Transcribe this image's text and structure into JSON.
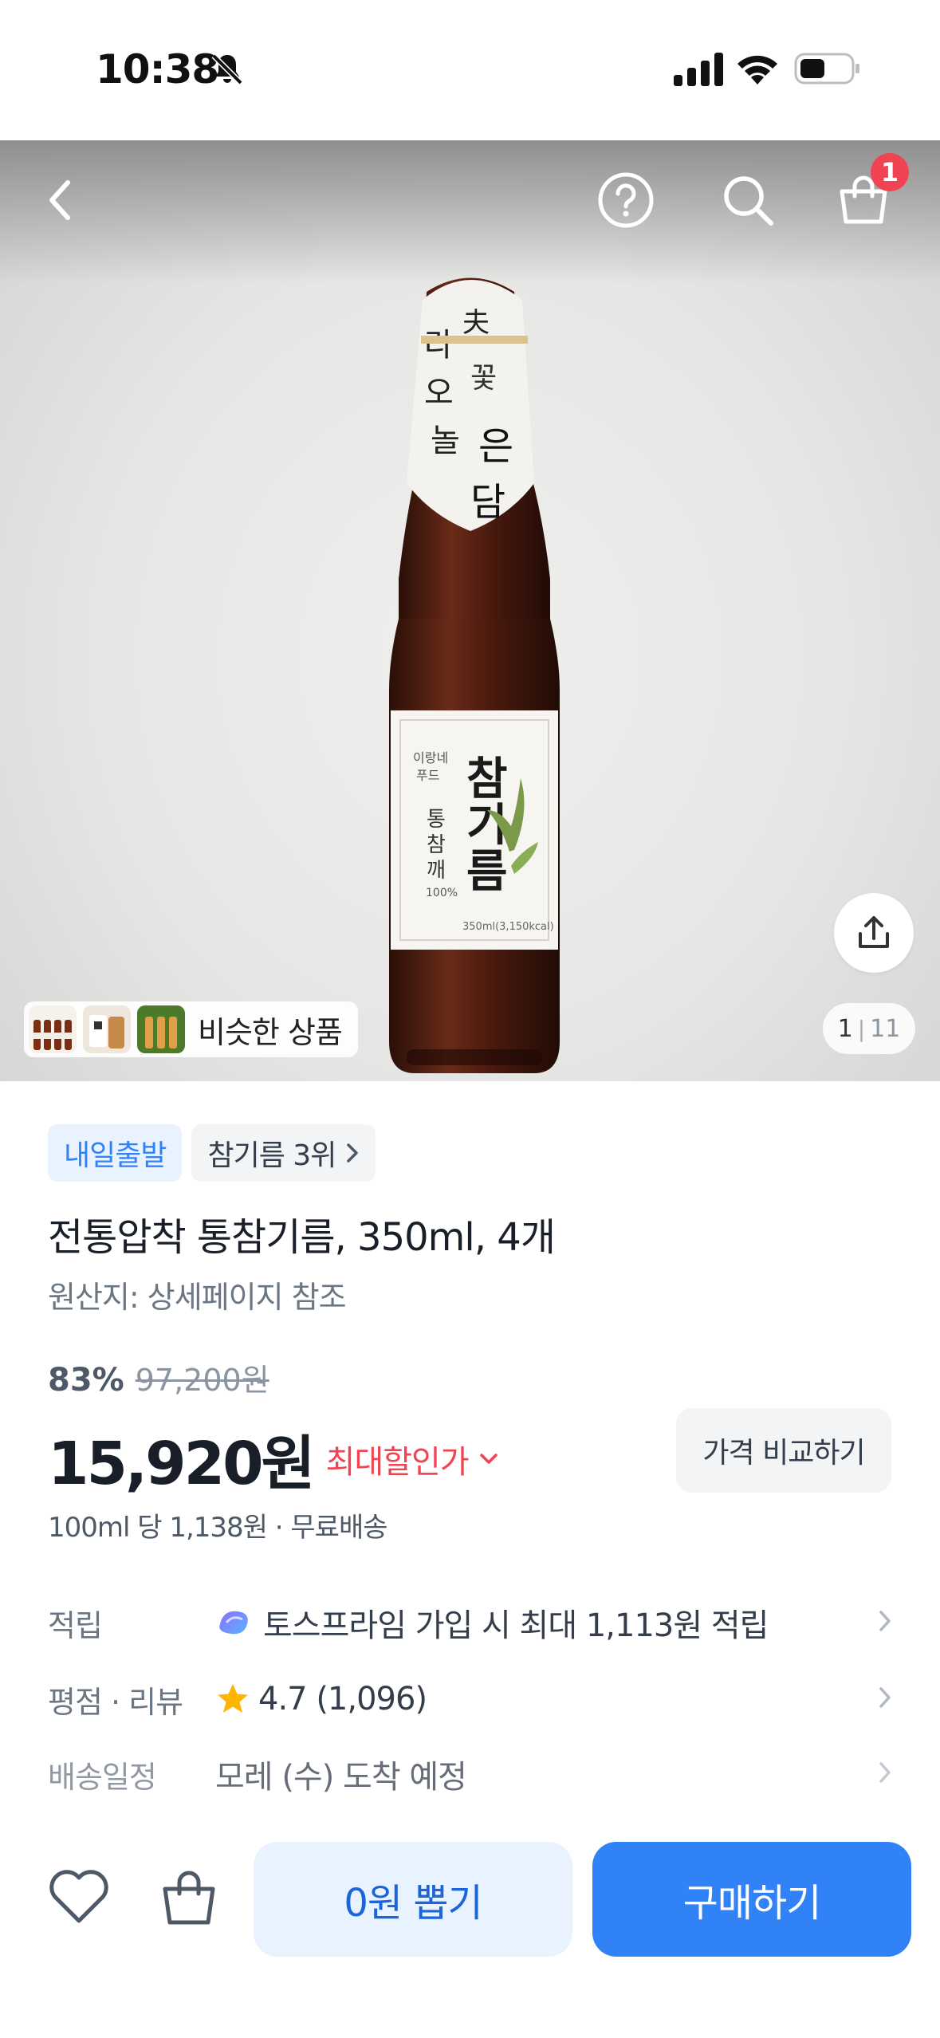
{
  "status_bar": {
    "time": "10:38"
  },
  "header": {
    "cart_badge": "1"
  },
  "gallery": {
    "current": "1",
    "separator": "|",
    "total": "11",
    "similar_label": "비슷한 상품"
  },
  "tags": {
    "tomorrow": "내일출발",
    "rank": "참기름 3위"
  },
  "product": {
    "title": "전통압착 통참기름, 350ml, 4개",
    "origin": "원산지: 상세페이지 참조",
    "discount_rate": "83%",
    "original_price": "97,200원",
    "price": "15,920원",
    "max_discount_label": "최대할인가",
    "compare_label": "가격 비교하기",
    "unit_price": "100ml 당 1,138원 · 무료배송"
  },
  "info": {
    "points_label": "적립",
    "points_value": "토스프라임 가입 시 최대 1,113원 적립",
    "rating_label": "평점 · 리뷰",
    "rating_value": "4.7 (1,096)",
    "delivery_label": "배송일정",
    "delivery_value": "모레 (수) 도착 예정"
  },
  "bottom": {
    "draw_label": "0원 뽑기",
    "buy_label": "구매하기"
  },
  "colors": {
    "primary": "#3182f6",
    "primary_light": "#e8f3ff",
    "sale_red": "#f04452",
    "star": "#ffb400"
  }
}
